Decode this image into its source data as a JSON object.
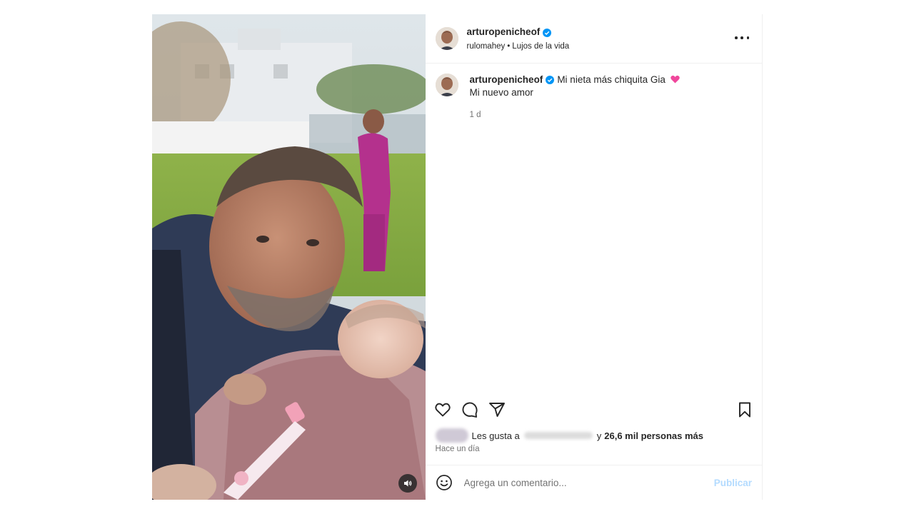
{
  "post": {
    "author": {
      "username": "arturopenicheof",
      "verified": true,
      "verified_icon": "verified-badge-icon",
      "subtitle_user": "rulomahey",
      "subtitle_separator": "•",
      "subtitle_audio": "Lujos de la vida"
    },
    "caption": {
      "username": "arturopenicheof",
      "text": "Mi nieta más chiquita Gia",
      "emoji": "pink-heart-icon",
      "line2": "Mi nuevo amor",
      "time": "1 d"
    },
    "actions": {
      "like_icon": "heart-icon",
      "comment_icon": "comment-icon",
      "share_icon": "share-icon",
      "save_icon": "bookmark-icon"
    },
    "likes": {
      "prefix": "Les gusta a",
      "connector": "y",
      "count_text": "26,6 mil personas más"
    },
    "date": "Hace un día",
    "comment": {
      "placeholder": "Agrega un comentario...",
      "publish_label": "Publicar"
    },
    "media": {
      "audio_icon": "speaker-icon"
    },
    "colors": {
      "accent": "#0095f6",
      "publish_disabled": "#b3dbff",
      "secondary_text": "#737373",
      "divider": "#efefef"
    }
  }
}
